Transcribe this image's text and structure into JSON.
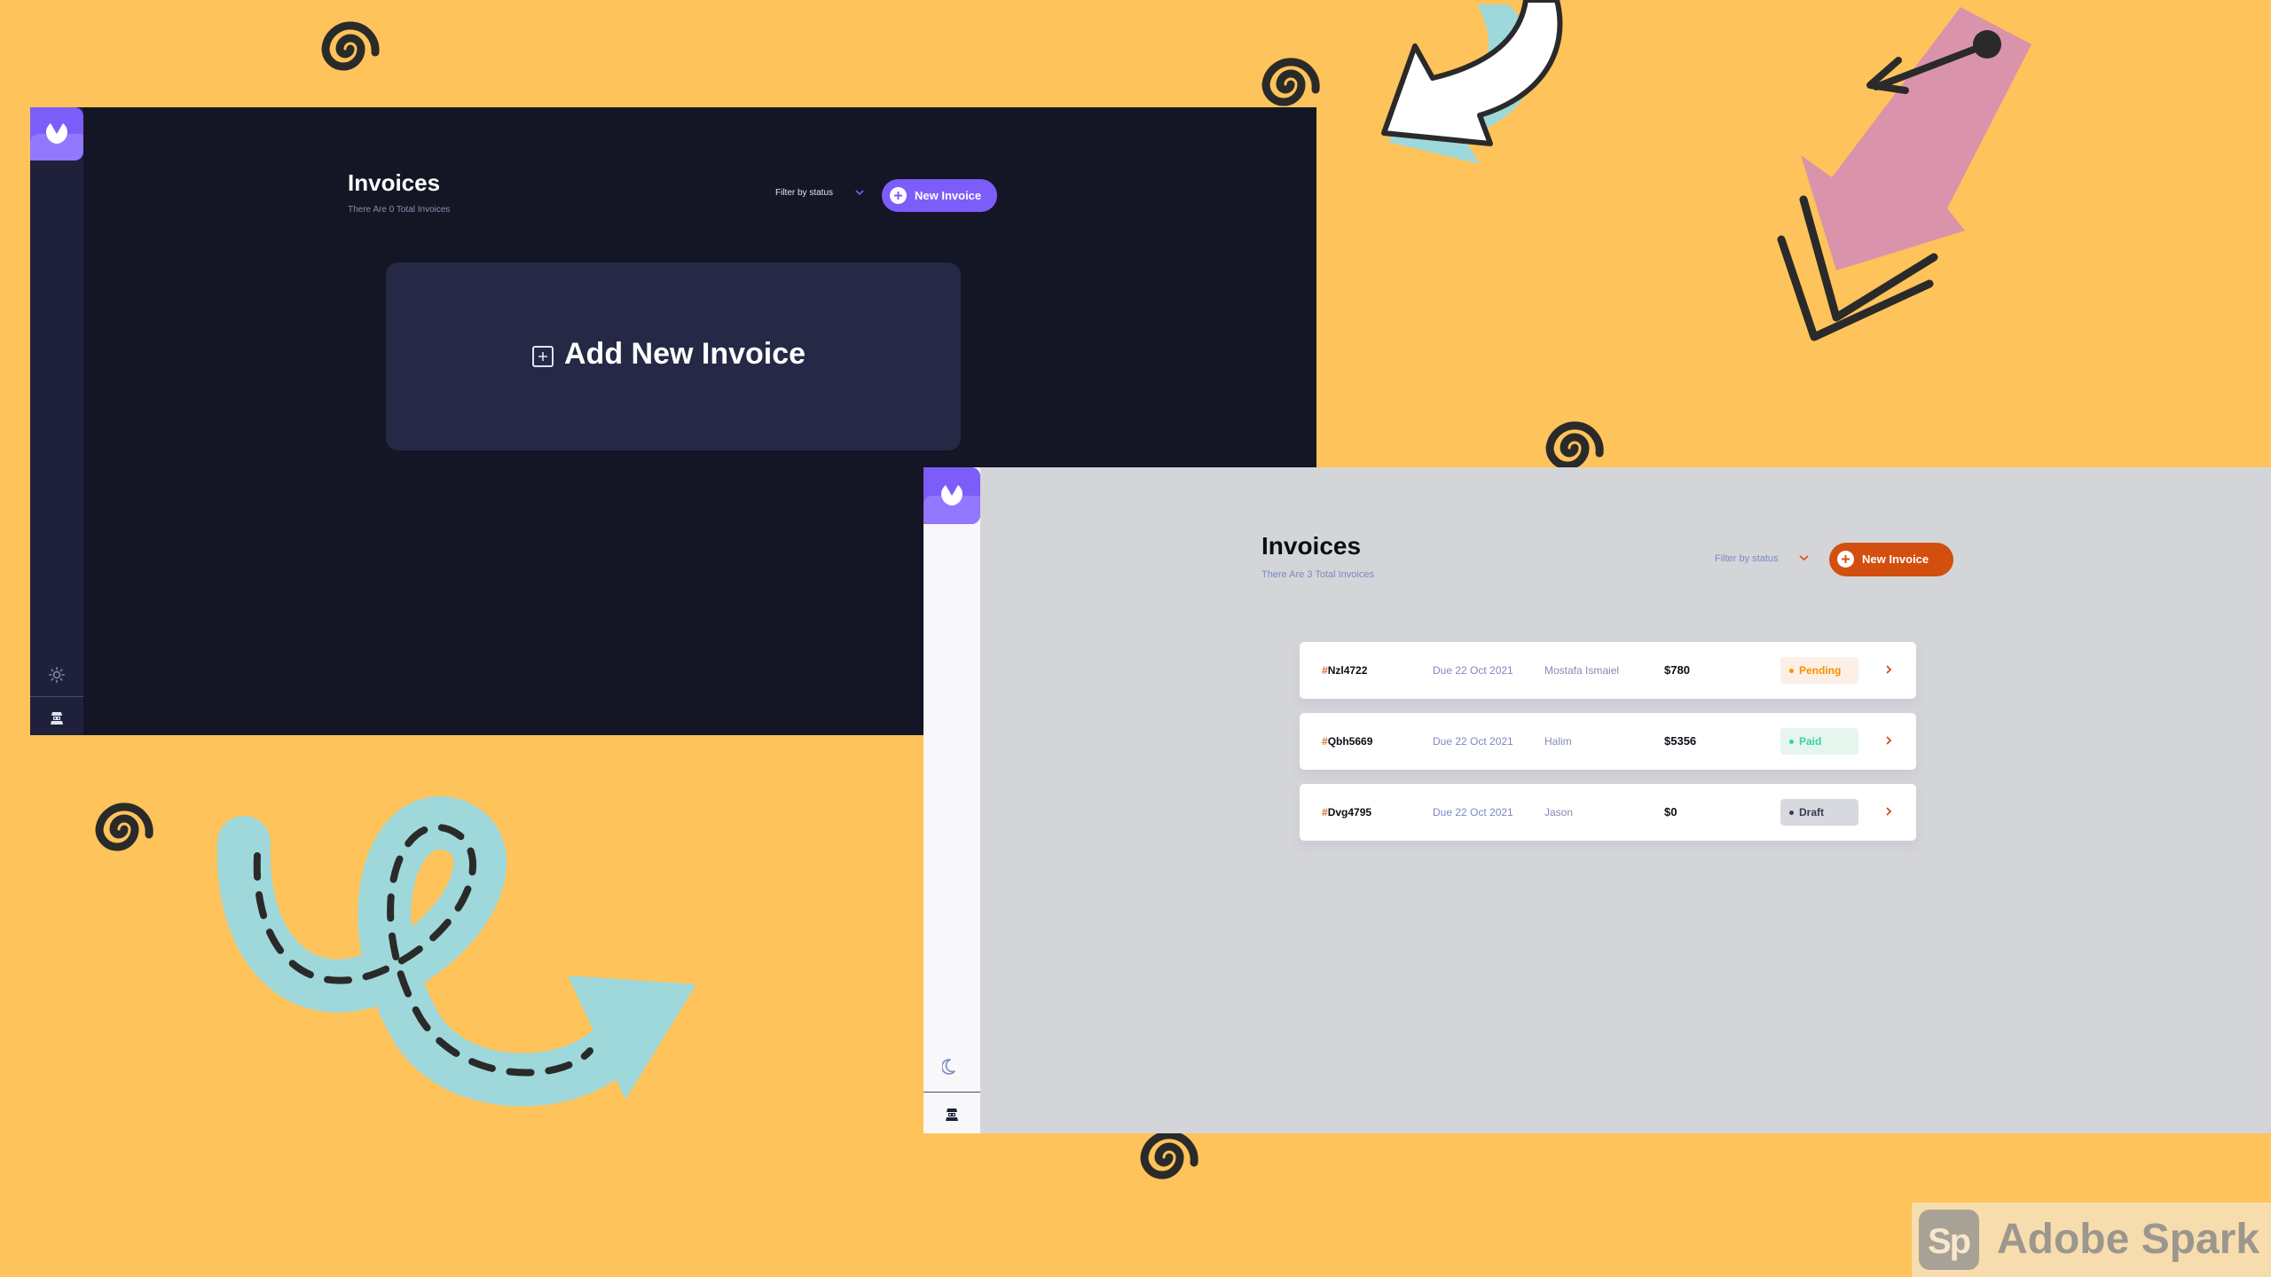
{
  "colors": {
    "background": "#FEC35A",
    "dark_bg": "#141625",
    "dark_sidebar": "#1E2139",
    "accent_purple": "#7C5DFA",
    "light_bg": "#D4D5D9",
    "accent_orange": "#D34F0F"
  },
  "dark_app": {
    "title": "Invoices",
    "subtitle": "There Are 0 Total Invoices",
    "filter_label": "Filter by status",
    "new_invoice_label": "New Invoice",
    "add_card_label": "Add New Invoice",
    "theme_icon": "sun-icon",
    "logo_icon": "logo-icon",
    "avatar_icon": "avatar-icon"
  },
  "light_app": {
    "title": "Invoices",
    "subtitle": "There Are 3 Total Invoices",
    "filter_label": "Filter by status",
    "new_invoice_label": "New Invoice",
    "theme_icon": "moon-icon",
    "logo_icon": "logo-icon",
    "avatar_icon": "avatar-icon",
    "invoices": [
      {
        "hash": "#",
        "id": "Nzl4722",
        "due": "Due 22 Oct 2021",
        "client": "Mostafa Ismaiel",
        "amount": "$780",
        "status": "Pending"
      },
      {
        "hash": "#",
        "id": "Qbh5669",
        "due": "Due 22 Oct 2021",
        "client": "Halim",
        "amount": "$5356",
        "status": "Paid"
      },
      {
        "hash": "#",
        "id": "Dvg4795",
        "due": "Due 22 Oct 2021",
        "client": "Jason",
        "amount": "$0",
        "status": "Draft"
      }
    ]
  },
  "watermark": {
    "tile": "Sp",
    "text": "Adobe Spark"
  }
}
